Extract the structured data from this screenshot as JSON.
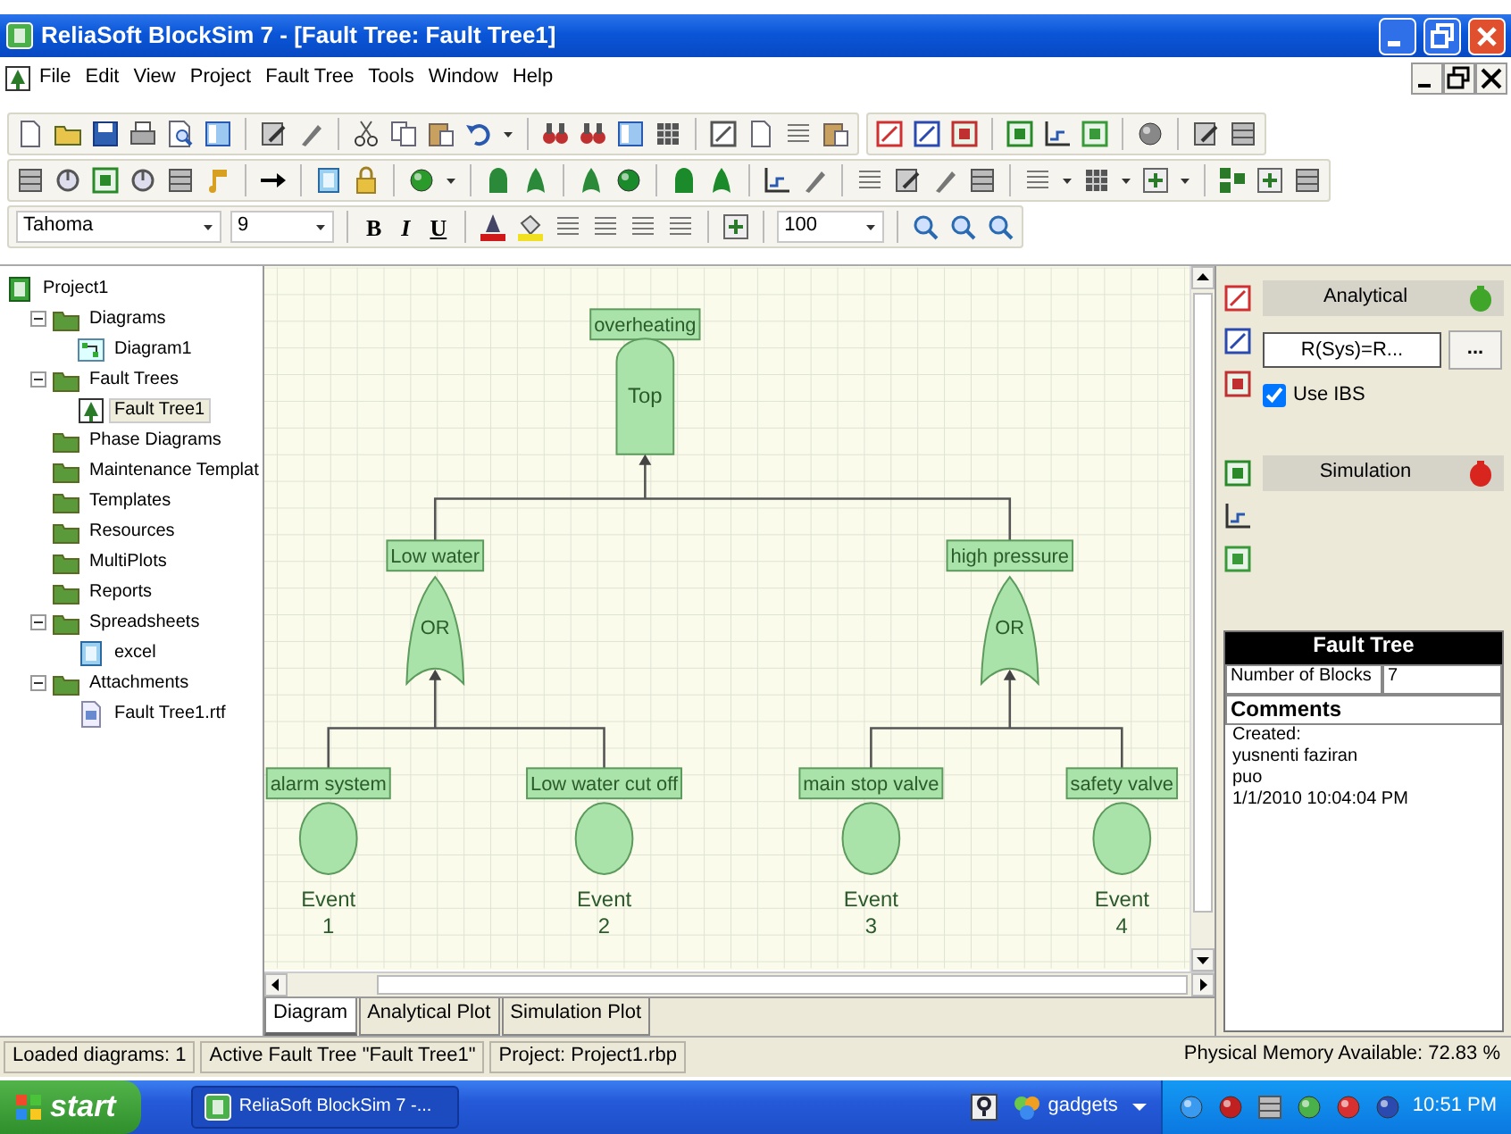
{
  "window": {
    "title": "ReliaSoft BlockSim 7 - [Fault Tree: Fault Tree1]"
  },
  "menu": [
    "File",
    "Edit",
    "View",
    "Project",
    "Fault Tree",
    "Tools",
    "Window",
    "Help"
  ],
  "format_bar": {
    "font": "Tahoma",
    "size": "9",
    "bold": "B",
    "italic": "I",
    "underline": "U",
    "zoom": "100"
  },
  "project_tree": {
    "label": "Project1",
    "children": [
      {
        "label": "Diagrams",
        "kind": "folder",
        "expanded": true,
        "selected": false,
        "children": [
          {
            "label": "Diagram1",
            "kind": "diagram",
            "selected": false
          }
        ]
      },
      {
        "label": "Fault Trees",
        "kind": "folder",
        "expanded": true,
        "selected": false,
        "children": [
          {
            "label": "Fault Tree1",
            "kind": "faulttree",
            "selected": true
          }
        ]
      },
      {
        "label": "Phase Diagrams",
        "kind": "folder",
        "selected": false
      },
      {
        "label": "Maintenance Templat",
        "kind": "folder",
        "selected": false
      },
      {
        "label": "Templates",
        "kind": "folder",
        "selected": false
      },
      {
        "label": "Resources",
        "kind": "folder",
        "selected": false
      },
      {
        "label": "MultiPlots",
        "kind": "folder",
        "selected": false
      },
      {
        "label": "Reports",
        "kind": "folder",
        "selected": false
      },
      {
        "label": "Spreadsheets",
        "kind": "folder",
        "expanded": true,
        "selected": false,
        "children": [
          {
            "label": "excel",
            "kind": "spreadsheet",
            "selected": false
          }
        ]
      },
      {
        "label": "Attachments",
        "kind": "folder",
        "expanded": true,
        "selected": false,
        "children": [
          {
            "label": "Fault Tree1.rtf",
            "kind": "attachment",
            "selected": false
          }
        ]
      }
    ]
  },
  "diagram": {
    "root": {
      "label": "overheating",
      "kind": "top",
      "symbol": "Top",
      "children": [
        {
          "label": "Low water",
          "kind": "or",
          "symbol": "OR",
          "children": [
            {
              "label": "alarm system",
              "kind": "event",
              "name": "Event",
              "number": "1"
            },
            {
              "label": "Low water cut off",
              "kind": "event",
              "name": "Event",
              "number": "2"
            }
          ]
        },
        {
          "label": "high pressure",
          "kind": "or",
          "symbol": "OR",
          "children": [
            {
              "label": "main stop valve",
              "kind": "event",
              "name": "Event",
              "number": "3"
            },
            {
              "label": "safety valve",
              "kind": "event",
              "name": "Event",
              "number": "4"
            }
          ]
        }
      ]
    }
  },
  "tabs": [
    {
      "label": "Diagram",
      "selected": true
    },
    {
      "label": "Analytical Plot",
      "selected": false
    },
    {
      "label": "Simulation Plot",
      "selected": false
    }
  ],
  "analytical": {
    "title": "Analytical",
    "color": "#3fa62a",
    "equation": "R(Sys)=R...",
    "browse": "...",
    "use_ibs": {
      "label": "Use IBS",
      "checked": true
    }
  },
  "simulation": {
    "title": "Simulation",
    "color": "#d8261e"
  },
  "properties": {
    "title": "Fault Tree",
    "rows": [
      {
        "label": "Number of Blocks",
        "value": "7"
      }
    ],
    "comments_title": "Comments",
    "comments": [
      "Created:",
      "yusnenti faziran",
      "puo",
      "1/1/2010 10:04:04 PM"
    ]
  },
  "status_bar": [
    "Loaded diagrams: 1",
    "Active Fault Tree \"Fault Tree1\"",
    "Project: Project1.rbp",
    "Physical Memory Available: 72.83 %"
  ],
  "taskbar": {
    "start": "start",
    "tasks": [
      {
        "label": "ReliaSoft BlockSim 7 -...",
        "selected": true
      }
    ],
    "toolbar": "gadgets",
    "clock": "10:51 PM"
  }
}
